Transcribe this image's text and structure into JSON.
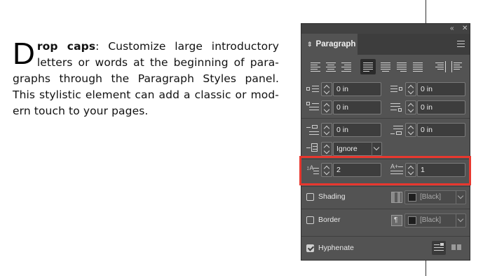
{
  "doc": {
    "dropcap": "D",
    "lead": "rop caps",
    "body": ": Customize large introductory letters or words at the beginning of para-graphs through the Paragraph Styles panel. This stylistic element can add a classic or mod-ern touch to your pages."
  },
  "panel": {
    "tab_label": "Paragraph",
    "left_indent": "0 in",
    "right_indent": "0 in",
    "first_line_indent": "0 in",
    "last_line_indent": "0 in",
    "space_before": "0 in",
    "space_after": "0 in",
    "align_to_grid": "Ignore",
    "drop_cap_lines": "2",
    "drop_cap_chars": "1",
    "shading_label": "Shading",
    "shading_color": "[Black]",
    "border_label": "Border",
    "border_color": "[Black]",
    "hyphenate_label": "Hyphenate",
    "hyphenate_checked": true,
    "shading_checked": false,
    "border_checked": false,
    "highlight_color": "#e8372e"
  }
}
